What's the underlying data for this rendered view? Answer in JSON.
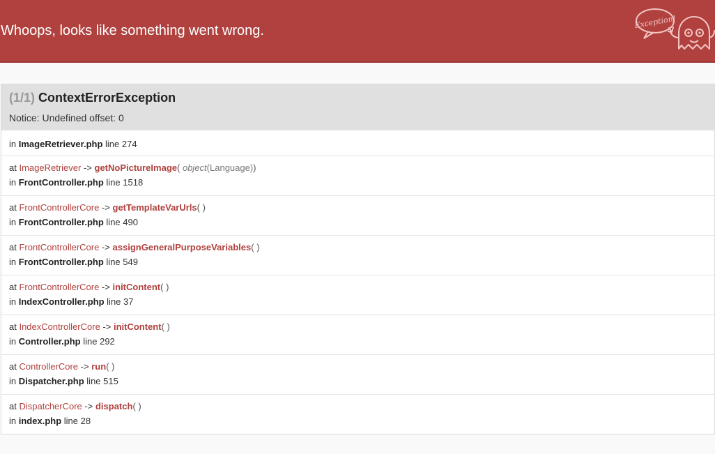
{
  "header": {
    "title": "Whoops, looks like something went wrong.",
    "bubble_text": "Exception!"
  },
  "exception": {
    "count": "(1/1)",
    "name": "ContextErrorException",
    "message": "Notice: Undefined offset: 0"
  },
  "first_location": {
    "prefix": "in",
    "file": "ImageRetriever.php",
    "line_label": "line",
    "line": "274"
  },
  "frames": [
    {
      "at": "at",
      "class": "ImageRetriever",
      "arrow": "->",
      "function": "getNoPictureImage",
      "open": "(",
      "arg_type": "object",
      "arg_value": "(Language)",
      "close": ")",
      "in": "in",
      "file": "FrontController.php",
      "line_label": "line",
      "line": "1518"
    },
    {
      "at": "at",
      "class": "FrontControllerCore",
      "arrow": "->",
      "function": "getTemplateVarUrls",
      "open": "(",
      "arg_type": "",
      "arg_value": "",
      "close": ")",
      "in": "in",
      "file": "FrontController.php",
      "line_label": "line",
      "line": "490"
    },
    {
      "at": "at",
      "class": "FrontControllerCore",
      "arrow": "->",
      "function": "assignGeneralPurposeVariables",
      "open": "(",
      "arg_type": "",
      "arg_value": "",
      "close": ")",
      "in": "in",
      "file": "FrontController.php",
      "line_label": "line",
      "line": "549"
    },
    {
      "at": "at",
      "class": "FrontControllerCore",
      "arrow": "->",
      "function": "initContent",
      "open": "(",
      "arg_type": "",
      "arg_value": "",
      "close": ")",
      "in": "in",
      "file": "IndexController.php",
      "line_label": "line",
      "line": "37"
    },
    {
      "at": "at",
      "class": "IndexControllerCore",
      "arrow": "->",
      "function": "initContent",
      "open": "(",
      "arg_type": "",
      "arg_value": "",
      "close": ")",
      "in": "in",
      "file": "Controller.php",
      "line_label": "line",
      "line": "292"
    },
    {
      "at": "at",
      "class": "ControllerCore",
      "arrow": "->",
      "function": "run",
      "open": "(",
      "arg_type": "",
      "arg_value": "",
      "close": ")",
      "in": "in",
      "file": "Dispatcher.php",
      "line_label": "line",
      "line": "515"
    },
    {
      "at": "at",
      "class": "DispatcherCore",
      "arrow": "->",
      "function": "dispatch",
      "open": "(",
      "arg_type": "",
      "arg_value": "",
      "close": ")",
      "in": "in",
      "file": "index.php",
      "line_label": "line",
      "line": "28"
    }
  ],
  "colors": {
    "header_bg": "#b0413e",
    "accent": "#b0413e",
    "panel_head_bg": "#e0e0e0"
  },
  "icons": {
    "mascot": "ghost-mascot-icon",
    "bubble": "speech-bubble-icon"
  }
}
